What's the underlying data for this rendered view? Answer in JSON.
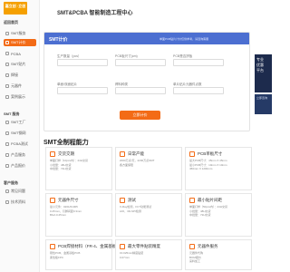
{
  "brand": {
    "logo_text": "嘉立创 ·立创",
    "site_title": "SMT&PCBA 智能制造工程中心"
  },
  "sidebar": {
    "sections": [
      {
        "title": "返回首页"
      },
      {
        "title": "SMT 服务"
      },
      {
        "title": "客户服务"
      }
    ],
    "items_top": [
      {
        "label": "SMT服务",
        "active": false
      },
      {
        "label": "SMT计价",
        "active": true
      },
      {
        "label": "PCBA",
        "active": false
      },
      {
        "label": "SMT贴片",
        "active": false
      },
      {
        "label": "焊接",
        "active": false
      },
      {
        "label": "元器件",
        "active": false
      },
      {
        "label": "案例展示",
        "active": false
      }
    ],
    "items_mid": [
      {
        "label": "SMT工厂"
      },
      {
        "label": "SMT钢网"
      },
      {
        "label": "PCBA测试"
      },
      {
        "label": "产品服务"
      },
      {
        "label": "产品报价"
      }
    ],
    "items_bottom": [
      {
        "label": "常见问题"
      },
      {
        "label": "技术资料"
      }
    ]
  },
  "calc": {
    "title": "SMT计价",
    "note": "单面PCB贴片计价仅供参考，请咨询客服",
    "fields": [
      {
        "label": "生产数量（pcs）"
      },
      {
        "label": "PCB板尺寸(cm)"
      },
      {
        "label": "PCB是否拼板"
      },
      {
        "label": "单面/双面贴片"
      },
      {
        "label": "焊料种类"
      },
      {
        "label": "单片贴片元器件点数"
      }
    ],
    "button_label": "立即计价"
  },
  "capability": {
    "title": "SMT全制程能力",
    "cards": [
      {
        "title": "交货交期",
        "lines": [
          "单面打样（10pcs内）：24H交货",
          "小批量：48H交货",
          "中批量：72H交货"
        ]
      },
      {
        "title": "日常产能",
        "lines": [
          "2000万点/天，2200万点SMT",
          "各方面保障"
        ]
      },
      {
        "title": "PCB单板尺寸",
        "lines": [
          "最大PCB尺寸：45mm X 45mm",
          "最小PCB尺寸：10mm X 10mm",
          "450mm X 1200mm"
        ]
      },
      {
        "title": "元器件尺寸",
        "lines": [
          "最小元件：0201/01005",
          "0.25mm，引脚间距0.3mm",
          "BGA 0.25mm"
        ]
      },
      {
        "title": "测试",
        "lines": [
          "X-Ray检测，FCT功能测试",
          "AOI、3D-SPI检测"
        ]
      },
      {
        "title": "最小贴片间距",
        "lines": [
          "单面打样（50pcs内）：24H交货",
          "小批量：48H交货",
          "中批量：72H交货"
        ]
      },
      {
        "title": "PCB焊接材料（FR-4、金属基板）",
        "lines": [
          "刚性PCB、金属基板PCB",
          "柔性板FPC"
        ]
      },
      {
        "title": "最大零件贴装精度",
        "lines": [
          "±0.025mm精度贴装",
          "0.07mm"
        ]
      },
      {
        "title": "元器件服务",
        "lines": [
          "元器件代购",
          "BOM报价",
          "来料加工"
        ]
      }
    ]
  },
  "promo": {
    "lines": [
      "专业",
      "优惠",
      "平台"
    ],
    "sub": "立即咨询"
  }
}
